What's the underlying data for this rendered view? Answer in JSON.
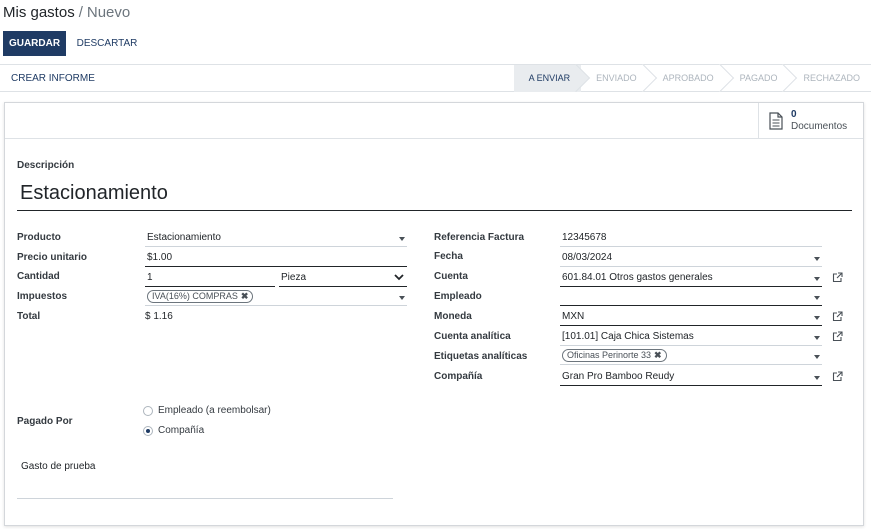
{
  "breadcrumb": {
    "parent": "Mis gastos",
    "separator": "/",
    "current": "Nuevo"
  },
  "toolbar": {
    "save_label": "GUARDAR",
    "discard_label": "DESCARTAR"
  },
  "statusbar": {
    "report_label": "CREAR INFORME",
    "stages": [
      "A ENVIAR",
      "ENVIADO",
      "APROBADO",
      "PAGADO",
      "RECHAZADO"
    ],
    "current_stage": "A ENVIAR"
  },
  "docs": {
    "count": "0",
    "label": "Documentos"
  },
  "form": {
    "description_label": "Descripción",
    "description_value": "Estacionamiento",
    "left": {
      "product_label": "Producto",
      "product_value": "Estacionamiento",
      "unit_price_label": "Precio unitario",
      "unit_price_value": "$1.00",
      "quantity_label": "Cantidad",
      "quantity_value": "1",
      "uom_value": "Pieza",
      "taxes_label": "Impuestos",
      "taxes_tag": "IVA(16%) COMPRAS",
      "total_label": "Total",
      "total_value": "$ 1.16"
    },
    "right": {
      "invoice_ref_label": "Referencia Factura",
      "invoice_ref_value": "12345678",
      "date_label": "Fecha",
      "date_value": "08/03/2024",
      "account_label": "Cuenta",
      "account_value": "601.84.01 Otros gastos generales",
      "employee_label": "Empleado",
      "employee_value": "",
      "currency_label": "Moneda",
      "currency_value": "MXN",
      "analytic_account_label": "Cuenta analítica",
      "analytic_account_value": "[101.01] Caja Chica Sistemas",
      "analytic_tags_label": "Etiquetas analíticas",
      "analytic_tags_tag": "Oficinas Perinorte 33",
      "company_label": "Compañía",
      "company_value": "Gran Pro Bamboo Reudy"
    },
    "paid_by": {
      "label": "Pagado Por",
      "options": [
        "Empleado (a reembolsar)",
        "Compañía"
      ],
      "selected": "Compañía"
    },
    "note_value": "Gasto de prueba"
  },
  "colors": {
    "primary": "#1f3b64",
    "stage_current_bg": "#e9ecef",
    "muted": "#adb5bd"
  }
}
